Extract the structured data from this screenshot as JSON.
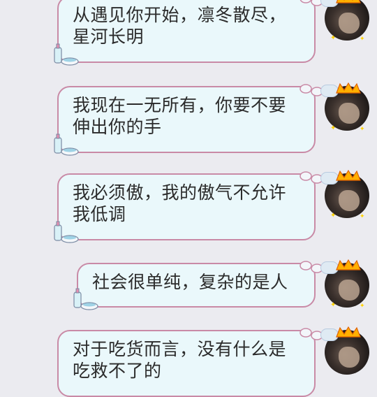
{
  "messages": [
    {
      "text": "从遇见你开始，凛冬散尽，星河长明"
    },
    {
      "text": "我现在一无所有，你要不要伸出你的手"
    },
    {
      "text": "我必须傲，我的傲气不允许我低调"
    },
    {
      "text": "社会很单纯，复杂的是人"
    },
    {
      "text": "对于吃货而言，没有什么是吃救不了的"
    }
  ],
  "colors": {
    "background": "#ebebf0",
    "bubble_fill": "#eaf8fb",
    "bubble_border": "#c98aa6"
  }
}
